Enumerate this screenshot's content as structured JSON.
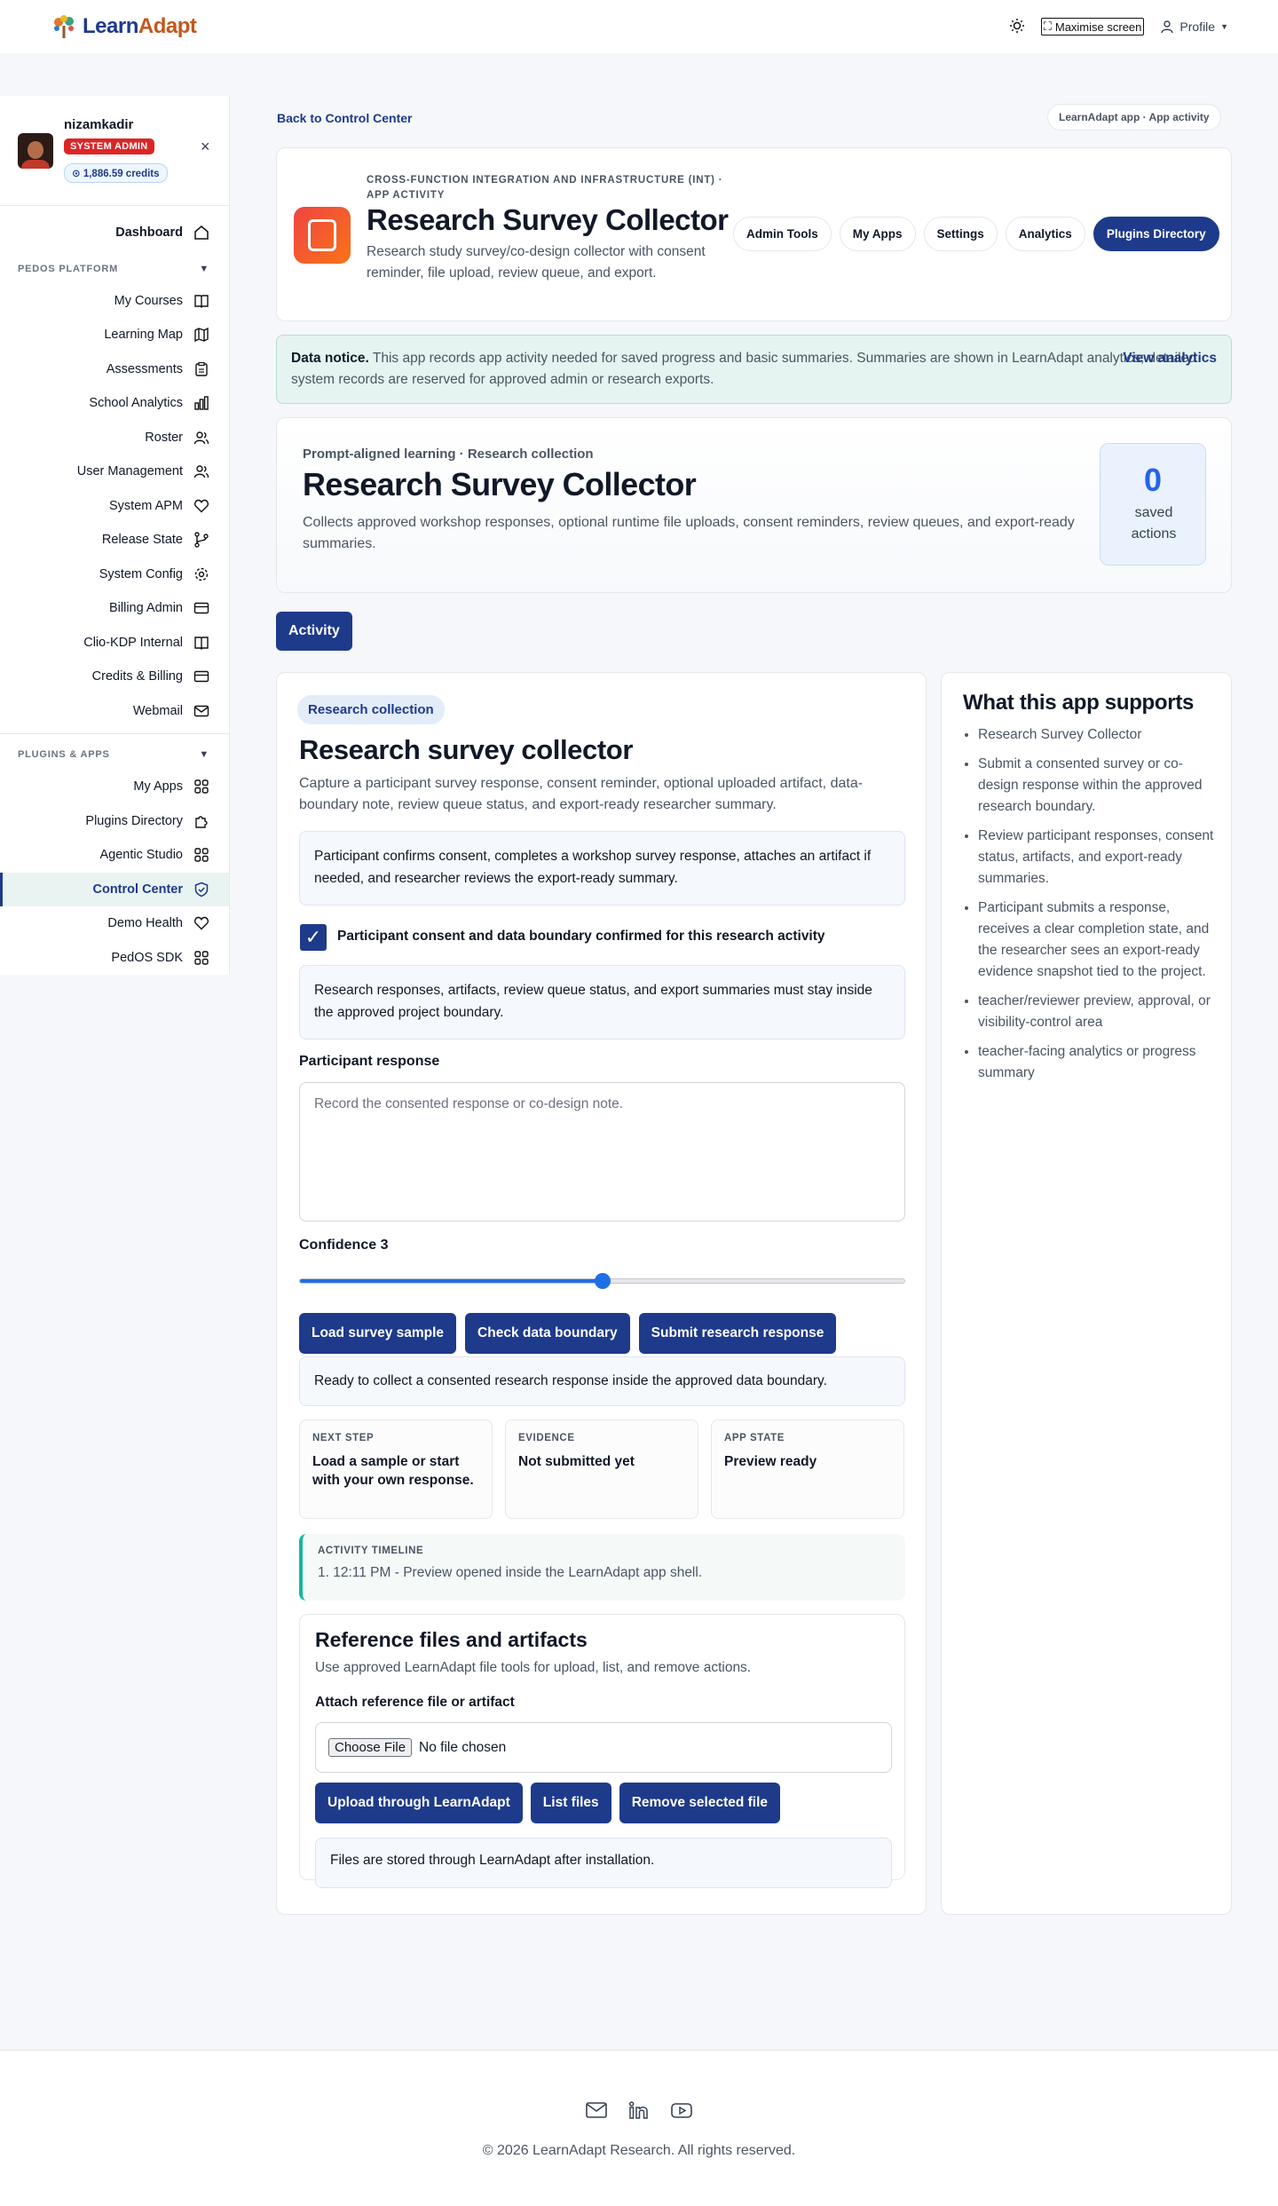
{
  "topbar": {
    "brand_part1": "Learn",
    "brand_part2": "Adapt",
    "maximise_label": "Maximise screen",
    "profile_label": "Profile"
  },
  "user": {
    "name": "nizamkadir",
    "role_badge": "SYSTEM ADMIN",
    "credits": "1,886.59 credits"
  },
  "sidebar": {
    "dashboard": "Dashboard",
    "section1": "PEDOS PLATFORM",
    "items1": [
      "My Courses",
      "Learning Map",
      "Assessments",
      "School Analytics",
      "Roster",
      "User Management",
      "System APM",
      "Release State",
      "System Config",
      "Billing Admin",
      "Clio-KDP Internal",
      "Credits & Billing",
      "Webmail"
    ],
    "section2": "PLUGINS & APPS",
    "items2": [
      "My Apps",
      "Plugins Directory",
      "Agentic Studio",
      "Control Center",
      "Demo Health",
      "PedOS SDK"
    ],
    "active": "Control Center"
  },
  "page": {
    "back_link": "Back to Control Center",
    "app_tag": "LearnAdapt app · App activity"
  },
  "header": {
    "eyebrow": "CROSS-FUNCTION INTEGRATION AND INFRASTRUCTURE (INT) · APP ACTIVITY",
    "title": "Research Survey Collector",
    "description": "Research study survey/co-design collector with consent reminder, file upload, review queue, and export.",
    "pills": [
      "Admin Tools",
      "My Apps",
      "Settings",
      "Analytics",
      "Plugins Directory"
    ]
  },
  "notice": {
    "label": "Data notice.",
    "text": "This app records app activity needed for saved progress and basic summaries. Summaries are shown in LearnAdapt analytics; detailed system records are reserved for approved admin or research exports.",
    "link": "View analytics"
  },
  "hero": {
    "eyebrow": "Prompt-aligned learning · Research collection",
    "title": "Research Survey Collector",
    "description": "Collects approved workshop responses, optional runtime file uploads, consent reminders, review queues, and export-ready summaries.",
    "saved_count": "0",
    "saved_label": "saved actions"
  },
  "tab": "Activity",
  "activity": {
    "chip": "Research collection",
    "title": "Research survey collector",
    "subtitle": "Capture a participant survey response, consent reminder, optional uploaded artifact, data-boundary note, review queue status, and export-ready researcher summary.",
    "intro_box": "Participant confirms consent, completes a workshop survey response, attaches an artifact if needed, and researcher reviews the export-ready summary.",
    "consent_label": "Participant consent and data boundary confirmed for this research activity",
    "consent_checked": true,
    "boundary_box": "Research responses, artifacts, review queue status, and export summaries must stay inside the approved project boundary.",
    "response_label": "Participant response",
    "response_placeholder": "Record the consented response or co-design note.",
    "confidence_label": "Confidence 3",
    "confidence_value": 3,
    "confidence_max": 5,
    "buttons": [
      "Load survey sample",
      "Check data boundary",
      "Submit research response"
    ],
    "status": "Ready to collect a consented research response inside the approved data boundary.",
    "cards": [
      {
        "title": "NEXT STEP",
        "value": "Load a sample or start with your own response."
      },
      {
        "title": "EVIDENCE",
        "value": "Not submitted yet"
      },
      {
        "title": "APP STATE",
        "value": "Preview ready"
      }
    ],
    "timeline_title": "ACTIVITY TIMELINE",
    "timeline_entry": "1. 12:11 PM - Preview opened inside the LearnAdapt app shell."
  },
  "files": {
    "title": "Reference files and artifacts",
    "subtitle": "Use approved LearnAdapt file tools for upload, list, and remove actions.",
    "attach_label": "Attach reference file or artifact",
    "choose_label": "Choose File",
    "no_file": "No file chosen",
    "buttons": [
      "Upload through LearnAdapt",
      "List files",
      "Remove selected file"
    ],
    "status": "Files are stored through LearnAdapt after installation."
  },
  "supports": {
    "title": "What this app supports",
    "items": [
      "Research Survey Collector",
      "Submit a consented survey or co-design response within the approved research boundary.",
      "Review participant responses, consent status, artifacts, and export-ready summaries.",
      "Participant submits a response, receives a clear completion state, and the researcher sees an export-ready evidence snapshot tied to the project.",
      "teacher/reviewer preview, approval, or visibility-control area",
      "teacher-facing analytics or progress summary"
    ]
  },
  "footer": {
    "copyright": "© 2026 LearnAdapt Research. All rights reserved."
  }
}
